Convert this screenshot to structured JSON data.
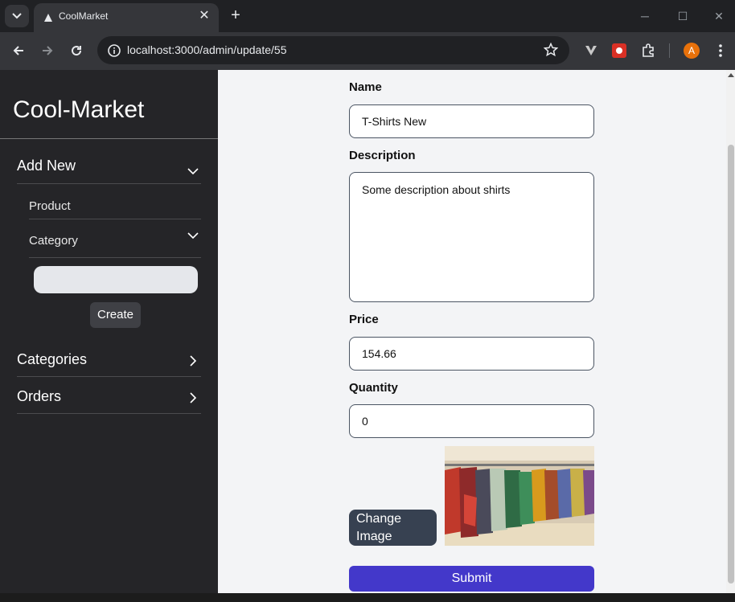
{
  "browser": {
    "tab_title": "CoolMarket",
    "tab_close_glyph": "✕",
    "new_tab_glyph": "+",
    "url": "localhost:3000/admin/update/55",
    "profile_initial": "A",
    "window_controls": {
      "minimize": "─",
      "maximize": "☐",
      "close": "✕"
    }
  },
  "sidebar": {
    "brand": "Cool-Market",
    "add_new": {
      "label": "Add New",
      "product_label": "Product",
      "category_label": "Category",
      "category_input_value": "",
      "create_label": "Create"
    },
    "categories_label": "Categories",
    "orders_label": "Orders"
  },
  "form": {
    "name_label": "Name",
    "name_value": "T-Shirts New",
    "description_label": "Description",
    "description_value": "Some description about shirts",
    "price_label": "Price",
    "price_value": "154.66",
    "quantity_label": "Quantity",
    "quantity_value": "0",
    "change_image_label": "Change Image",
    "submit_label": "Submit"
  },
  "colors": {
    "sidebar_bg": "#252528",
    "main_bg": "#f3f4f6",
    "submit_bg": "#4338ca",
    "change_image_bg": "#374151",
    "profile_avatar": "#e8710a"
  },
  "icons": {
    "tab_search": "chevron-down-icon",
    "favicon": "triangle-icon",
    "back": "arrow-left-icon",
    "forward": "arrow-right-icon",
    "reload": "reload-icon",
    "site_info": "info-icon",
    "bookmark": "star-icon",
    "vpn": "vpn-icon",
    "extension": "extension-red-icon",
    "extensions": "puzzle-icon",
    "menu": "kebab-menu-icon"
  }
}
